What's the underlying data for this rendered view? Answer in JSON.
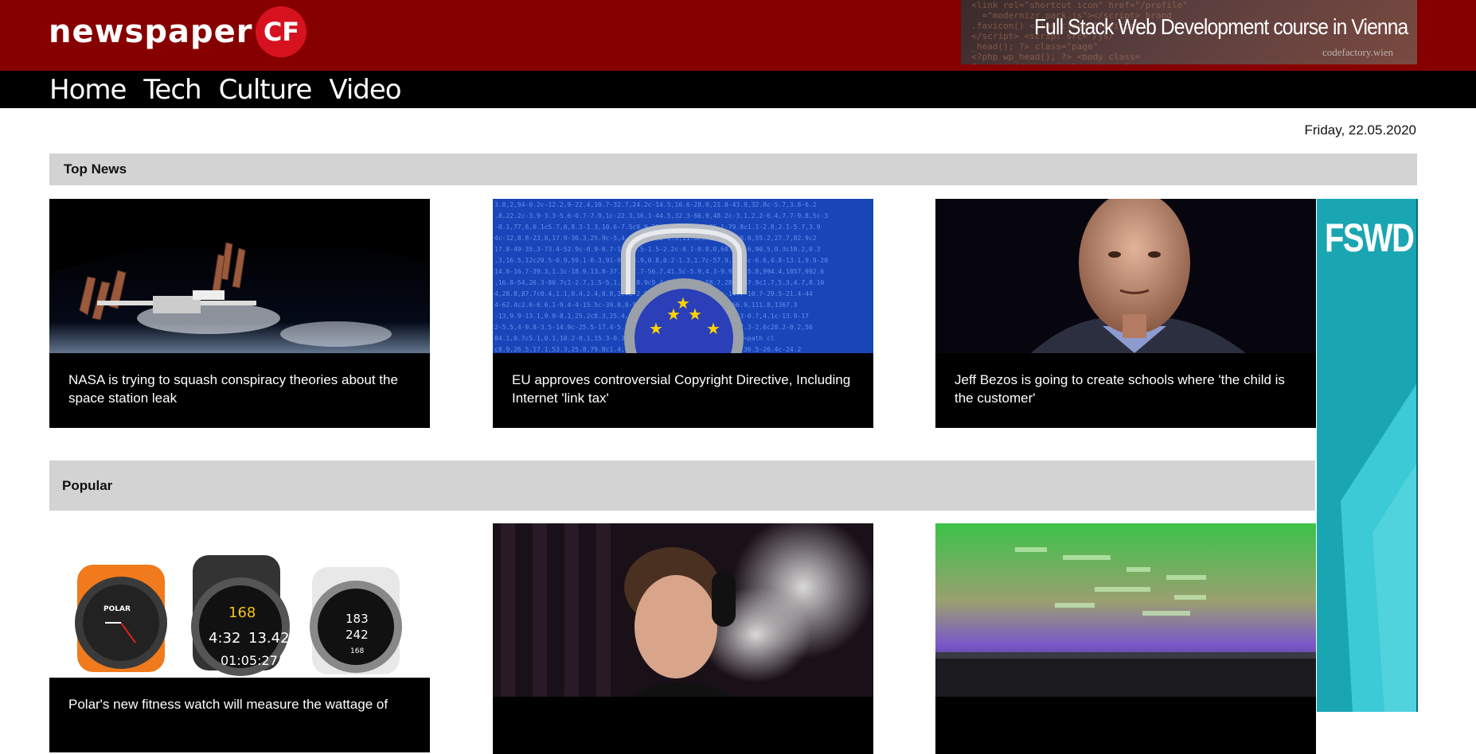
{
  "header": {
    "logo_text": "newspaper",
    "logo_badge": "CF",
    "banner": {
      "title": "Full Stack Web Development course in Vienna",
      "subtitle": "codefactory.wien"
    }
  },
  "nav": {
    "items": [
      {
        "label": "Home"
      },
      {
        "label": "Tech"
      },
      {
        "label": "Culture"
      },
      {
        "label": "Video"
      }
    ]
  },
  "date": "Friday, 22.05.2020",
  "sections": {
    "top_news": {
      "title": "Top News",
      "articles": [
        {
          "caption": "NASA is trying to squash conspiracy theories about the space station leak",
          "image": "space-station-earth"
        },
        {
          "caption": "EU approves controversial Copyright Directive, Including Internet 'link tax'",
          "image": "eu-padlock-code"
        },
        {
          "caption": "Jeff Bezos is going to create schools where 'the child is the customer'",
          "image": "jeff-bezos-portrait"
        }
      ]
    },
    "popular": {
      "title": "Popular",
      "articles": [
        {
          "caption": "Polar's new fitness watch will measure the wattage of",
          "image": "polar-watches"
        },
        {
          "caption": "",
          "image": "elon-musk-smoking"
        },
        {
          "caption": "",
          "image": "laptop-green-code"
        }
      ]
    }
  },
  "ad": {
    "text": "FSWD"
  },
  "colors": {
    "header_bg": "#870000",
    "nav_bg": "#000000",
    "section_bar": "#d3d3d3",
    "ad_teal": "#1a9fae"
  }
}
